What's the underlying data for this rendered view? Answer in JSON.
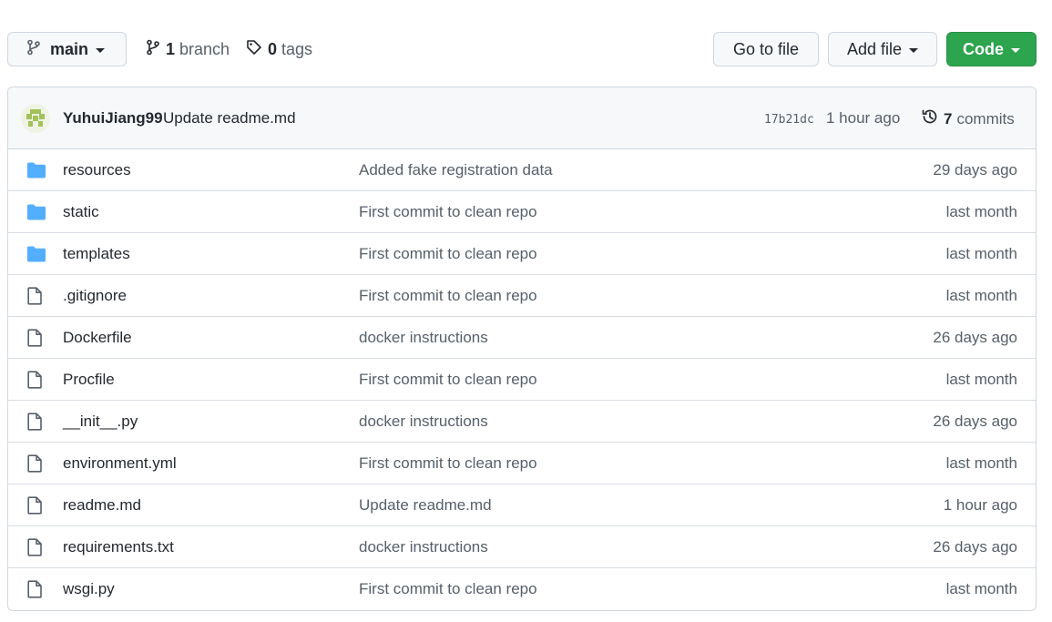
{
  "toolbar": {
    "branch_label": "main",
    "branch_count": "1",
    "branch_word": "branch",
    "tag_count": "0",
    "tag_word": "tags",
    "goto_file": "Go to file",
    "add_file": "Add file",
    "code": "Code"
  },
  "latest_commit": {
    "author": "YuhuiJiang99",
    "message": "Update readme.md",
    "sha": "17b21dc",
    "time": "1 hour ago",
    "commit_count": "7",
    "commit_word": "commits"
  },
  "files": [
    {
      "type": "folder-icon",
      "name": "resources",
      "message": "Added fake registration data",
      "age": "29 days ago"
    },
    {
      "type": "folder-icon",
      "name": "static",
      "message": "First commit to clean repo",
      "age": "last month"
    },
    {
      "type": "folder-icon",
      "name": "templates",
      "message": "First commit to clean repo",
      "age": "last month"
    },
    {
      "type": "file-icon",
      "name": ".gitignore",
      "message": "First commit to clean repo",
      "age": "last month"
    },
    {
      "type": "file-icon",
      "name": "Dockerfile",
      "message": "docker instructions",
      "age": "26 days ago"
    },
    {
      "type": "file-icon",
      "name": "Procfile",
      "message": "First commit to clean repo",
      "age": "last month"
    },
    {
      "type": "file-icon",
      "name": "__init__.py",
      "message": "docker instructions",
      "age": "26 days ago"
    },
    {
      "type": "file-icon",
      "name": "environment.yml",
      "message": "First commit to clean repo",
      "age": "last month"
    },
    {
      "type": "file-icon",
      "name": "readme.md",
      "message": "Update readme.md",
      "age": "1 hour ago"
    },
    {
      "type": "file-icon",
      "name": "requirements.txt",
      "message": "docker instructions",
      "age": "26 days ago"
    },
    {
      "type": "file-icon",
      "name": "wsgi.py",
      "message": "First commit to clean repo",
      "age": "last month"
    }
  ],
  "colors": {
    "folder": "#54aeff",
    "file": "#57606a",
    "primary_button": "#2da44e",
    "avatar": "#a3c15a"
  }
}
